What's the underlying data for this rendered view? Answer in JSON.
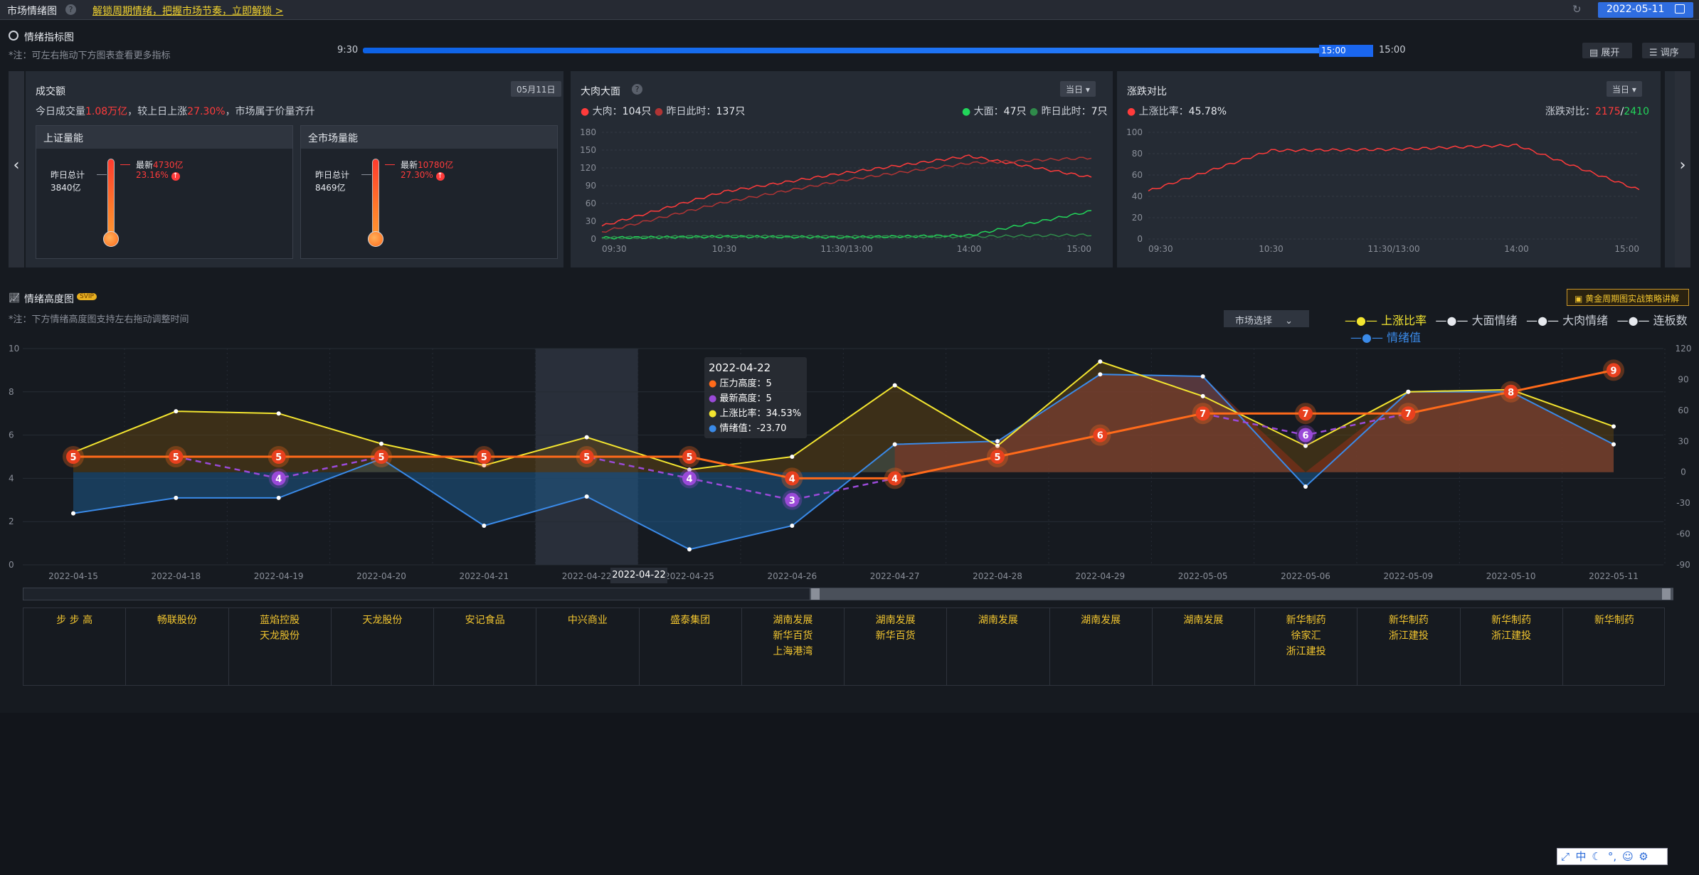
{
  "topbar": {
    "title": "市场情绪图",
    "help": "?",
    "promo": "解锁周期情绪，把握市场节奏，立即解锁 >",
    "date": "2022-05-11"
  },
  "indicator": {
    "title": "情绪指标图",
    "note": "*注：可左右拖动下方图表查看更多指标",
    "time_start": "9:30",
    "time_end": "15:00",
    "slider_label": "15:00",
    "expand_label": "展开",
    "order_label": "调序"
  },
  "card_turnover": {
    "title": "成交额",
    "date": "05月11日",
    "desc_prefix": "今日成交量",
    "desc_amount": "1.08万亿",
    "desc_mid": "，较上日上涨",
    "desc_pct": "27.30%",
    "desc_suffix": "，市场属于价量齐升",
    "panels": [
      {
        "title": "上证量能",
        "prev_label": "昨日总计",
        "prev_value": "3840亿",
        "latest_label": "最新",
        "latest_value": "4730亿",
        "pct": "23.16%"
      },
      {
        "title": "全市场量能",
        "prev_label": "昨日总计",
        "prev_value": "8469亿",
        "latest_label": "最新",
        "latest_value": "10780亿",
        "pct": "27.30%"
      }
    ]
  },
  "card_meat": {
    "title": "大肉大面",
    "dropdown": "当日",
    "l1": "大肉：",
    "v1": "104只",
    "l2": "昨日此时：",
    "v2": "137只",
    "l3": "大面：",
    "v3": "47只",
    "l4": "昨日此时：",
    "v4": "7只",
    "yticks": [
      "180",
      "150",
      "120",
      "90",
      "60",
      "30",
      "0"
    ],
    "xticks": [
      "09:30",
      "10:30",
      "11:30/13:00",
      "14:00",
      "15:00"
    ]
  },
  "card_ratio": {
    "title": "涨跌对比",
    "dropdown": "当日",
    "l1": "上涨比率：",
    "v1": "45.78%",
    "l2": "涨跌对比：",
    "v2a": "2175",
    "sep": "/",
    "v2b": "2410",
    "yticks": [
      "100",
      "80",
      "60",
      "40",
      "20",
      "0"
    ],
    "xticks": [
      "09:30",
      "10:30",
      "11:30/13:00",
      "14:00",
      "15:00"
    ]
  },
  "height_chart": {
    "title": "情绪高度图",
    "vip": "SVIP",
    "note": "*注：下方情绪高度图支持左右拖动调整时间",
    "market_select": "市场选择",
    "promo_btn": "黄金周期图实战策略讲解",
    "legend": [
      "上涨比率",
      "大面情绪",
      "大肉情绪",
      "连板数",
      "情绪值"
    ],
    "tooltip": {
      "date": "2022-04-22",
      "rows": [
        {
          "label": "压力高度：",
          "value": "5"
        },
        {
          "label": "最新高度：",
          "value": "5"
        },
        {
          "label": "上涨比率：",
          "value": "34.53%"
        },
        {
          "label": "情绪值：",
          "value": "-23.70"
        }
      ]
    },
    "hover_date": "2022-04-22",
    "stocks": [
      [
        "步 步 高"
      ],
      [
        "畅联股份"
      ],
      [
        "蓝焰控股",
        "天龙股份"
      ],
      [
        "天龙股份"
      ],
      [
        "安记食品"
      ],
      [
        "中兴商业"
      ],
      [
        "盛泰集团"
      ],
      [
        "湖南发展",
        "新华百货",
        "上海港湾"
      ],
      [
        "湖南发展",
        "新华百货"
      ],
      [
        "湖南发展"
      ],
      [
        "湖南发展"
      ],
      [
        "湖南发展"
      ],
      [
        "新华制药",
        "徐家汇",
        "浙江建投"
      ],
      [
        "新华制药",
        "浙江建投"
      ],
      [
        "新华制药",
        "浙江建投"
      ],
      [
        "新华制药"
      ]
    ]
  },
  "chart_data": [
    {
      "type": "line",
      "title": "大肉大面",
      "x": [
        "09:30",
        "10:30",
        "11:30/13:00",
        "14:00",
        "15:00"
      ],
      "ylim": [
        0,
        180
      ],
      "series": [
        {
          "name": "大肉",
          "color": "#ff3b3b",
          "values": [
            22,
            80,
            112,
            140,
            104
          ]
        },
        {
          "name": "昨日此时",
          "color": "#b03434",
          "values": [
            12,
            62,
            100,
            128,
            137
          ]
        },
        {
          "name": "大面",
          "color": "#22d65a",
          "values": [
            2,
            4,
            3,
            6,
            47
          ]
        },
        {
          "name": "昨日此时",
          "color": "#2f8a4a",
          "values": [
            2,
            5,
            4,
            4,
            7
          ]
        }
      ]
    },
    {
      "type": "line",
      "title": "涨跌对比",
      "x": [
        "09:30",
        "10:30",
        "11:30/13:00",
        "14:00",
        "15:00"
      ],
      "ylim": [
        0,
        100
      ],
      "series": [
        {
          "name": "上涨比率",
          "color": "#ff3b3b",
          "values": [
            45,
            83,
            84,
            88,
            46
          ]
        }
      ]
    },
    {
      "type": "line",
      "title": "情绪高度图",
      "categories": [
        "2022-04-15",
        "2022-04-18",
        "2022-04-19",
        "2022-04-20",
        "2022-04-21",
        "2022-04-22",
        "2022-04-25",
        "2022-04-26",
        "2022-04-27",
        "2022-04-28",
        "2022-04-29",
        "2022-05-05",
        "2022-05-06",
        "2022-05-09",
        "2022-05-10",
        "2022-05-11"
      ],
      "ylim_left": [
        0,
        10
      ],
      "ylim_right": [
        -90,
        120
      ],
      "yticks_left": [
        "10",
        "8",
        "6",
        "4",
        "2",
        "0"
      ],
      "yticks_right": [
        "120",
        "90",
        "60",
        "30",
        "0",
        "-30",
        "-60",
        "-90"
      ],
      "series": [
        {
          "name": "压力高度",
          "color": "#ff6a1a",
          "values": [
            5,
            5,
            5,
            5,
            5,
            5,
            5,
            4,
            4,
            5,
            6,
            7,
            7,
            7,
            8,
            9
          ]
        },
        {
          "name": "最新高度",
          "color": "#9a4ad8",
          "values": [
            null,
            5,
            4,
            5,
            null,
            5,
            4,
            3,
            4,
            null,
            null,
            7,
            6,
            7,
            null,
            null
          ]
        },
        {
          "name": "上涨比率",
          "color": "#f3e530",
          "values": [
            5.2,
            7.1,
            7.0,
            5.6,
            4.6,
            5.9,
            4.4,
            5.0,
            8.3,
            5.5,
            9.4,
            7.8,
            5.5,
            8.0,
            8.1,
            6.4
          ]
        },
        {
          "name": "情绪值",
          "color": "#3a8ae8",
          "values": [
            -40,
            -25,
            -25,
            13,
            -52,
            -23.7,
            -75,
            -52,
            27,
            30,
            95,
            93,
            -14,
            78,
            78,
            27
          ]
        }
      ]
    }
  ]
}
